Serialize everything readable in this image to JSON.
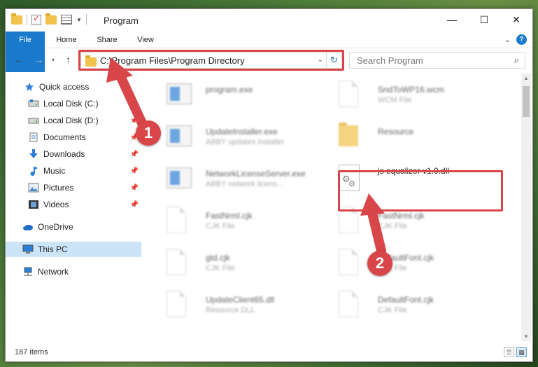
{
  "window": {
    "title": "Program",
    "buttons": {
      "minimize": "—",
      "maximize": "☐",
      "close": "✕"
    }
  },
  "ribbon": {
    "tabs": [
      "File",
      "Home",
      "Share",
      "View"
    ],
    "expand": "⌄",
    "help": "?"
  },
  "nav": {
    "back": "←",
    "forward": "→",
    "recent": "▾",
    "up": "↑",
    "address_path": "C:\\Program Files\\Program Directory",
    "address_dropdown": "⌄",
    "refresh": "↻",
    "search_placeholder": "Search Program",
    "search_icon": "⌕"
  },
  "sidebar": {
    "items": [
      {
        "label": "Quick access",
        "icon": "star-icon",
        "pinned": false
      },
      {
        "label": "Local Disk (C:)",
        "icon": "drive-icon",
        "pinned": false
      },
      {
        "label": "Local Disk (D:)",
        "icon": "drive-icon",
        "pinned": true
      },
      {
        "label": "Documents",
        "icon": "documents-icon",
        "pinned": true
      },
      {
        "label": "Downloads",
        "icon": "download-icon",
        "pinned": true
      },
      {
        "label": "Music",
        "icon": "music-icon",
        "pinned": true
      },
      {
        "label": "Pictures",
        "icon": "pictures-icon",
        "pinned": true
      },
      {
        "label": "Videos",
        "icon": "videos-icon",
        "pinned": true
      },
      {
        "label": "OneDrive",
        "icon": "cloud-icon",
        "pinned": false
      },
      {
        "label": "This PC",
        "icon": "computer-icon",
        "pinned": false
      },
      {
        "label": "Network",
        "icon": "network-icon",
        "pinned": false
      }
    ],
    "pin_glyph": "📌"
  },
  "files": [
    {
      "name": "program.exe",
      "sub": "",
      "icon": "app-icon"
    },
    {
      "name": "SndToWP16.wcm",
      "sub": "WCM File",
      "icon": "document-icon"
    },
    {
      "name": "UpdateInstaller.exe",
      "sub": "ABBY updates installer",
      "icon": "app-icon"
    },
    {
      "name": "Resource",
      "sub": "",
      "icon": "folder-icon"
    },
    {
      "name": "NetworkLicenseServer.exe",
      "sub": "ABBY network licens...",
      "icon": "app-icon"
    },
    {
      "name": "js equalizer v1.0.dll",
      "sub": "",
      "icon": "dll-gear-icon"
    },
    {
      "name": "FastNrml.cjk",
      "sub": "CJK File",
      "icon": "document-icon"
    },
    {
      "name": "FastNrml.cjk",
      "sub": "CJK File",
      "icon": "document-icon"
    },
    {
      "name": "gtd.cjk",
      "sub": "CJK File",
      "icon": "document-icon"
    },
    {
      "name": "DefaultFont.cjk",
      "sub": "CJK File",
      "icon": "document-icon"
    },
    {
      "name": "UpdateClient65.dll",
      "sub": "Resource DLL",
      "icon": "dll-gear-icon"
    },
    {
      "name": "DefaultFont.cjk",
      "sub": "CJK File",
      "icon": "document-icon"
    }
  ],
  "status": {
    "item_count": "187 items"
  },
  "annotations": {
    "step1": "1",
    "step2": "2",
    "color": "#d9464a"
  },
  "colors": {
    "accent": "#1979ca",
    "selected": "#cce4f7"
  }
}
